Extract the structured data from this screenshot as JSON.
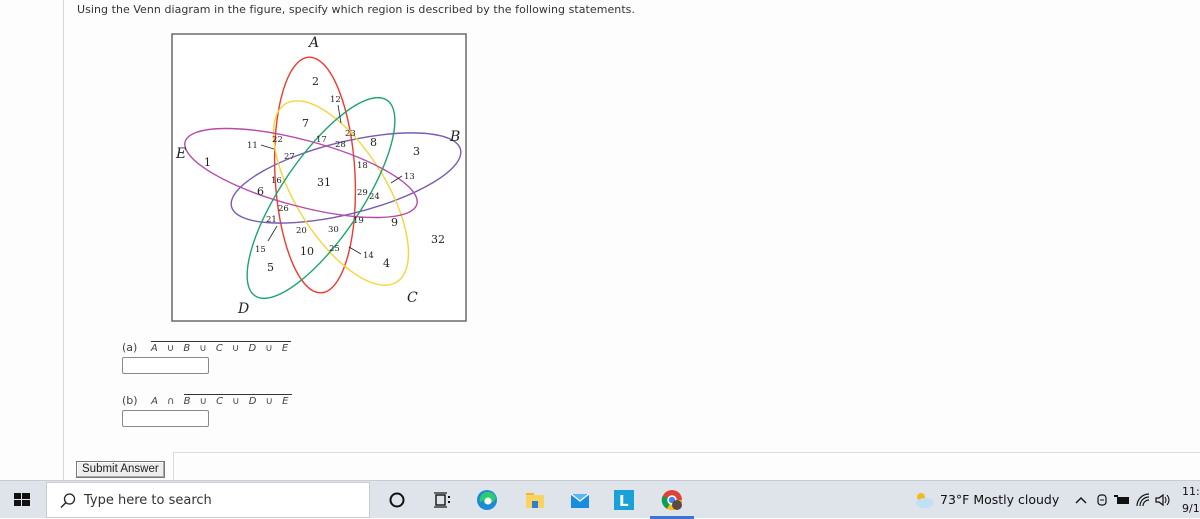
{
  "question": {
    "prompt": "Using the Venn diagram in the figure, specify which region is described by the following statements."
  },
  "venn": {
    "set_labels": {
      "A": "A",
      "B": "B",
      "C": "C",
      "D": "D",
      "E": "E"
    },
    "set_colors": {
      "A": "#ee3b2f",
      "B": "#7a5bb0",
      "C": "#f5d53a",
      "D": "#1ca46b",
      "E": "#b64aa8"
    },
    "regions": [
      "1",
      "2",
      "3",
      "4",
      "5",
      "6",
      "7",
      "8",
      "9",
      "10",
      "11",
      "12",
      "13",
      "14",
      "15",
      "16",
      "17",
      "18",
      "19",
      "20",
      "21",
      "22",
      "23",
      "24",
      "25",
      "26",
      "27",
      "28",
      "29",
      "30",
      "31",
      "32"
    ]
  },
  "parts": [
    {
      "label": "(a)",
      "expression": "A ∪ B ∪ C ∪ D ∪ E",
      "overline_all": true,
      "value": "",
      "placeholder": ""
    },
    {
      "label": "(b)",
      "expression_prefix": "A ∩ ",
      "expression_overlined": "B ∪ C ∪ D ∪ E",
      "value": "",
      "placeholder": ""
    }
  ],
  "submit_label": "Submit Answer",
  "taskbar": {
    "search_placeholder": "Type here to search",
    "apps": [
      "cortana",
      "task-view",
      "edge",
      "file-explorer",
      "mail",
      "lexia",
      "chrome"
    ],
    "weather": "73°F  Mostly cloudy",
    "time": "11:",
    "date": "9/1"
  }
}
